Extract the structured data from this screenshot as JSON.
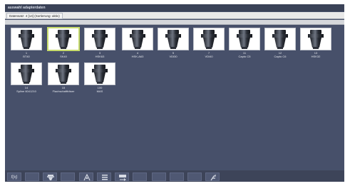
{
  "window": {
    "title": "auswahl adapterdaten"
  },
  "filter": {
    "label": "Datensatz: 4 [14] (Sortierung: aktiv)"
  },
  "tiles": [
    {
      "num": "1",
      "name": "BT40",
      "selected": false
    },
    {
      "num": "2",
      "name": "SK40",
      "selected": true
    },
    {
      "num": "3",
      "name": "HSK63",
      "selected": false
    },
    {
      "num": "4",
      "name": "HSK-A63",
      "selected": false
    },
    {
      "num": "5",
      "name": "VDI30",
      "selected": false
    },
    {
      "num": "7",
      "name": "VDI40",
      "selected": false
    },
    {
      "num": "11",
      "name": "Capto C5",
      "selected": false
    },
    {
      "num": "12",
      "name": "Capto C6",
      "selected": false
    },
    {
      "num": "13",
      "name": "HSK32",
      "selected": false
    },
    {
      "num": "14",
      "name": "Spline 6041210",
      "selected": false
    },
    {
      "num": "15",
      "name": "Flachschaftfräser",
      "selected": false
    },
    {
      "num": "100",
      "name": "MAS",
      "selected": false
    }
  ],
  "toolbar": {
    "buttons": [
      {
        "icon": "function-icon",
        "label": "f(x)"
      },
      {
        "icon": "blank-icon",
        "label": ""
      },
      {
        "icon": "holder-icon",
        "label": ""
      },
      {
        "icon": "blank-icon",
        "label": ""
      },
      {
        "icon": "measure-icon",
        "label": ""
      },
      {
        "icon": "list-icon",
        "label": ""
      },
      {
        "icon": "transfer-icon",
        "label": ""
      },
      {
        "icon": "blank-icon",
        "label": ""
      },
      {
        "icon": "blank-icon",
        "label": ""
      },
      {
        "icon": "blank-icon",
        "label": ""
      },
      {
        "icon": "blank-icon",
        "label": ""
      },
      {
        "icon": "settings-icon",
        "label": ""
      }
    ]
  }
}
